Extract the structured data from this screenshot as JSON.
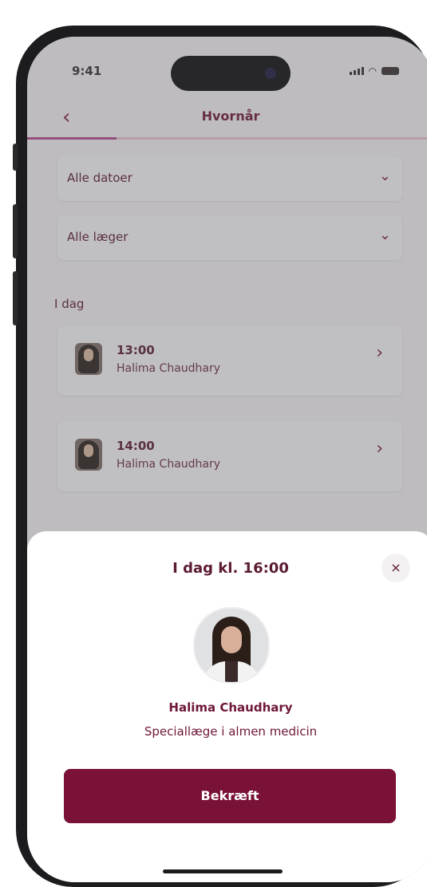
{
  "status_bar": {
    "time": "9:41"
  },
  "header": {
    "back_icon": "chevron-left-icon",
    "title": "Hvornår",
    "progress": 0.22
  },
  "filters": [
    {
      "label": "Alle datoer",
      "icon": "chevron-down-icon"
    },
    {
      "label": "Alle læger",
      "icon": "chevron-down-icon"
    }
  ],
  "section_title": "I dag",
  "slots": [
    {
      "time": "13:00",
      "doctor": "Halima Chaudhary"
    },
    {
      "time": "14:00",
      "doctor": "Halima Chaudhary"
    }
  ],
  "sheet": {
    "title": "I dag kl. 16:00",
    "close_symbol": "×",
    "doctor_name": "Halima Chaudhary",
    "doctor_specialty": "Speciallæge i almen medicin",
    "confirm_label": "Bekræft"
  },
  "colors": {
    "brand": "#7a1238",
    "text": "#5a1a33",
    "progress": "#b24b8d"
  }
}
